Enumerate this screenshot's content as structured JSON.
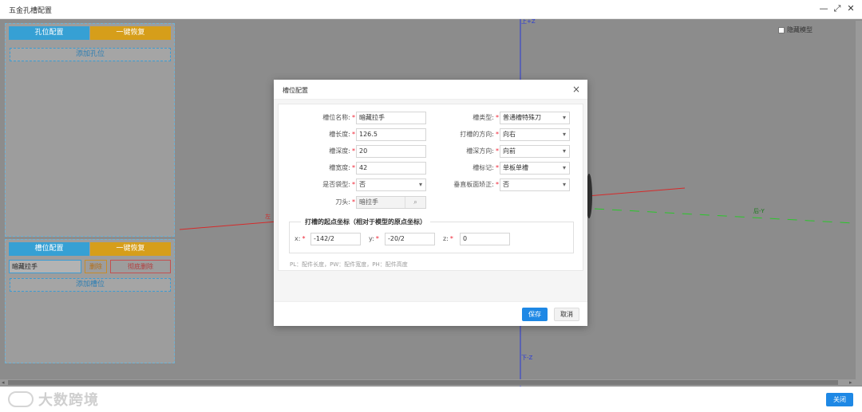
{
  "window": {
    "title": "五金孔槽配置",
    "minimize": "—",
    "maximize": "⤢",
    "close": "✕"
  },
  "viewport": {
    "axes": {
      "z_pos": "上+Z",
      "z_neg": "下-Z",
      "x_left": "左",
      "y_neg": "后-Y"
    },
    "hide_model_label": "隐藏模型",
    "hide_model_checked": false
  },
  "hole_panel": {
    "tab_config": "孔位配置",
    "tab_restore": "一键恢复",
    "add_label": "添加孔位"
  },
  "slot_panel": {
    "tab_config": "槽位配置",
    "tab_restore": "一键恢复",
    "items": [
      {
        "name": "暗藏拉手",
        "delete": "删除",
        "delete_all": "彻底删除"
      }
    ],
    "add_label": "添加槽位"
  },
  "footer": {
    "watermark": "大数跨境",
    "close_label": "关闭"
  },
  "dialog": {
    "title": "槽位配置",
    "close_icon": "×",
    "fields": {
      "slot_name": {
        "label": "槽位名称:",
        "value": "暗藏拉手"
      },
      "slot_length": {
        "label": "槽长度:",
        "value": "126.5"
      },
      "slot_depth": {
        "label": "槽深度:",
        "value": "20"
      },
      "slot_width": {
        "label": "槽宽度:",
        "value": "42"
      },
      "is_bag_type": {
        "label": "是否袋型:",
        "value": "否"
      },
      "cutter": {
        "label": "刀头:",
        "value": "暗拉手"
      },
      "slot_type": {
        "label": "槽类型:",
        "value": "普通槽特殊刀"
      },
      "direction": {
        "label": "打槽的方向:",
        "value": "向右"
      },
      "depth_direction": {
        "label": "槽深方向:",
        "value": "向前"
      },
      "slot_mark": {
        "label": "槽标记:",
        "value": "单板单槽"
      },
      "vertical_correction": {
        "label": "垂直板面矫正:",
        "value": "否"
      }
    },
    "origin": {
      "legend": "打槽的起点坐标（相对于模型的原点坐标）",
      "x_label": "x:",
      "x_value": "-142/2",
      "y_label": "y:",
      "y_value": "-20/2",
      "z_label": "z:",
      "z_value": "0"
    },
    "hint": "PL：配件长度，PW：配件宽度，PH：配件高度",
    "save_label": "保存",
    "cancel_label": "取消"
  }
}
